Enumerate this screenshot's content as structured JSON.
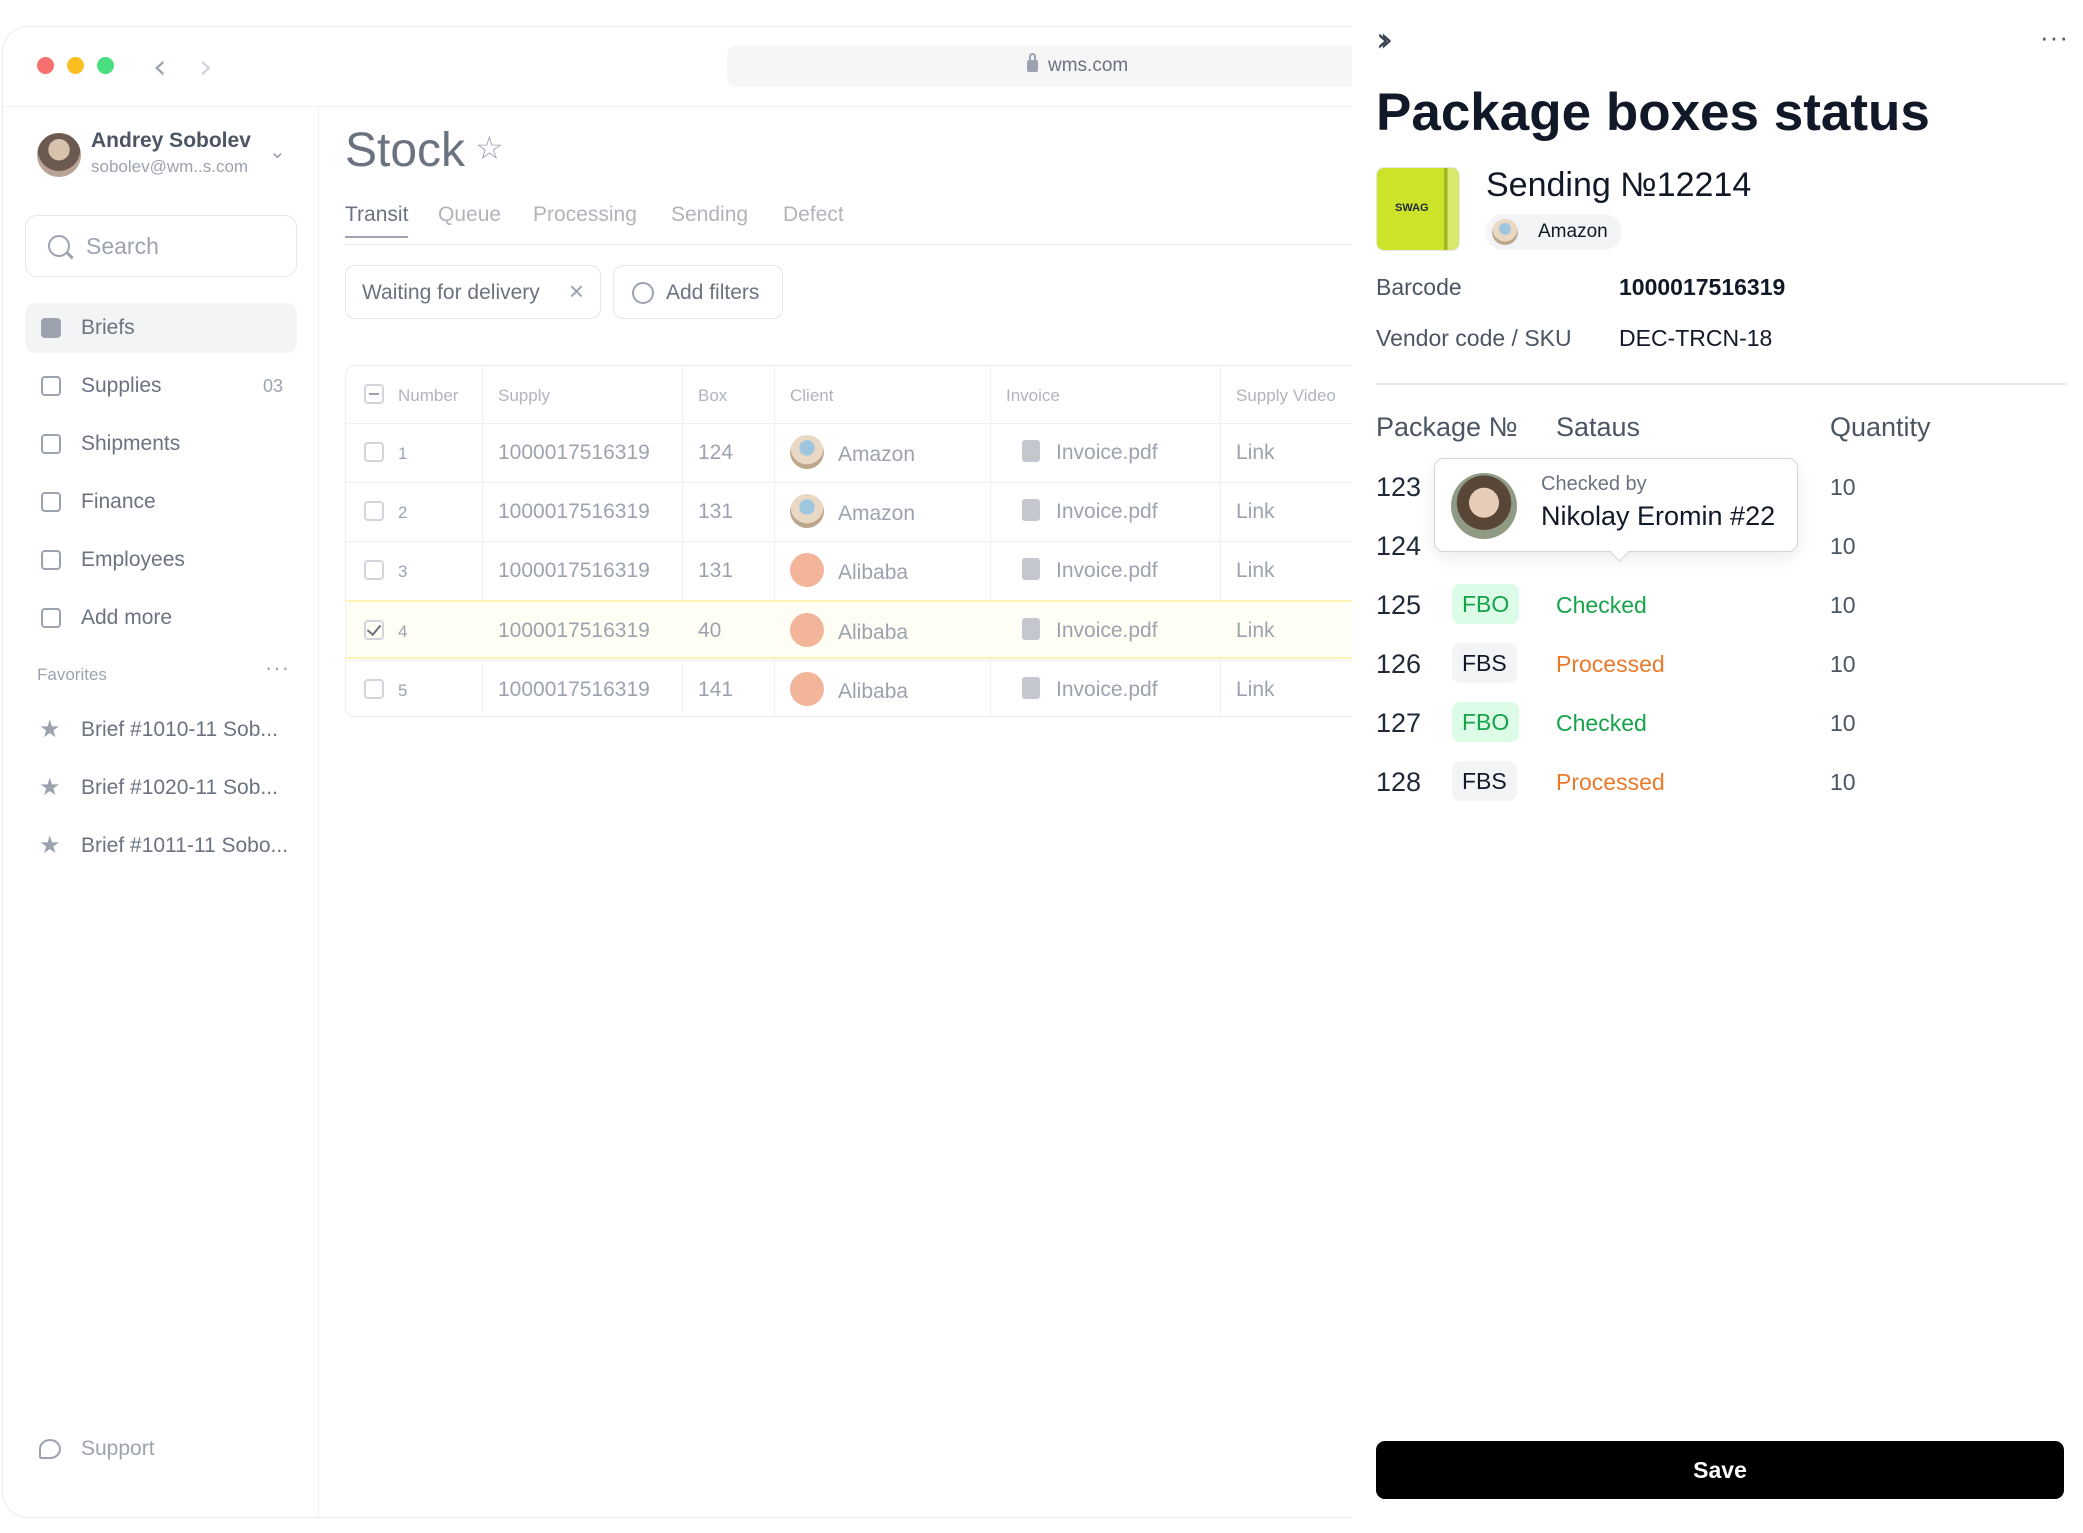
{
  "browser": {
    "url": "wms.com"
  },
  "user": {
    "name": "Andrey Sobolev",
    "email": "sobolev@wm..s.com"
  },
  "sidebar": {
    "search_placeholder": "Search",
    "items": [
      {
        "label": "Briefs"
      },
      {
        "label": "Supplies",
        "count": "03"
      },
      {
        "label": "Shipments"
      },
      {
        "label": "Finance"
      },
      {
        "label": "Employees"
      },
      {
        "label": "Add more"
      }
    ],
    "favorites_title": "Favorites",
    "favorites": [
      {
        "label": "Brief #1010-11 Sob..."
      },
      {
        "label": "Brief #1020-11 Sob..."
      },
      {
        "label": "Brief #1011-11 Sobo..."
      }
    ],
    "support_label": "Support"
  },
  "main": {
    "title": "Stock",
    "tabs": [
      {
        "label": "Transit"
      },
      {
        "label": "Queue"
      },
      {
        "label": "Processing"
      },
      {
        "label": "Sending"
      },
      {
        "label": "Defect"
      }
    ],
    "filter_chip": "Waiting for delivery",
    "add_filters_label": "Add filters",
    "table": {
      "headers": [
        "Number",
        "Supply",
        "Box",
        "Client",
        "Invoice",
        "Supply Video"
      ],
      "rows": [
        {
          "number": "1",
          "supply": "1000017516319",
          "box": "124",
          "client": "Amazon",
          "invoice": "Invoice.pdf",
          "video": "Link"
        },
        {
          "number": "2",
          "supply": "1000017516319",
          "box": "131",
          "client": "Amazon",
          "invoice": "Invoice.pdf",
          "video": "Link"
        },
        {
          "number": "3",
          "supply": "1000017516319",
          "box": "131",
          "client": "Alibaba",
          "invoice": "Invoice.pdf",
          "video": "Link"
        },
        {
          "number": "4",
          "supply": "1000017516319",
          "box": "40",
          "client": "Alibaba",
          "invoice": "Invoice.pdf",
          "video": "Link"
        },
        {
          "number": "5",
          "supply": "1000017516319",
          "box": "141",
          "client": "Alibaba",
          "invoice": "Invoice.pdf",
          "video": "Link"
        }
      ]
    }
  },
  "panel": {
    "title": "Package boxes status",
    "sending_title": "Sending №12214",
    "product_label": "SWAG",
    "client": "Amazon",
    "barcode_label": "Barcode",
    "barcode_value": "1000017516319",
    "sku_label": "Vendor code / SKU",
    "sku_value": "DEC-TRCN-18",
    "columns": {
      "package": "Package №",
      "status": "Sataus",
      "quantity": "Quantity"
    },
    "packages": [
      {
        "number": "123",
        "type": "",
        "status": "",
        "quantity": "10"
      },
      {
        "number": "124",
        "type": "",
        "status": "",
        "quantity": "10"
      },
      {
        "number": "125",
        "type": "FBO",
        "status": "Checked",
        "quantity": "10"
      },
      {
        "number": "126",
        "type": "FBS",
        "status": "Processed",
        "quantity": "10"
      },
      {
        "number": "127",
        "type": "FBO",
        "status": "Checked",
        "quantity": "10"
      },
      {
        "number": "128",
        "type": "FBS",
        "status": "Processed",
        "quantity": "10"
      }
    ],
    "tooltip": {
      "label": "Checked by",
      "name": "Nikolay Eromin #22"
    },
    "save_label": "Save"
  },
  "colors": {
    "accent": "#000000",
    "checked": "#16a34a",
    "processed": "#ea7a2a",
    "fbo_bg": "#dcfce7",
    "selected_row": "#fdf3b5"
  }
}
